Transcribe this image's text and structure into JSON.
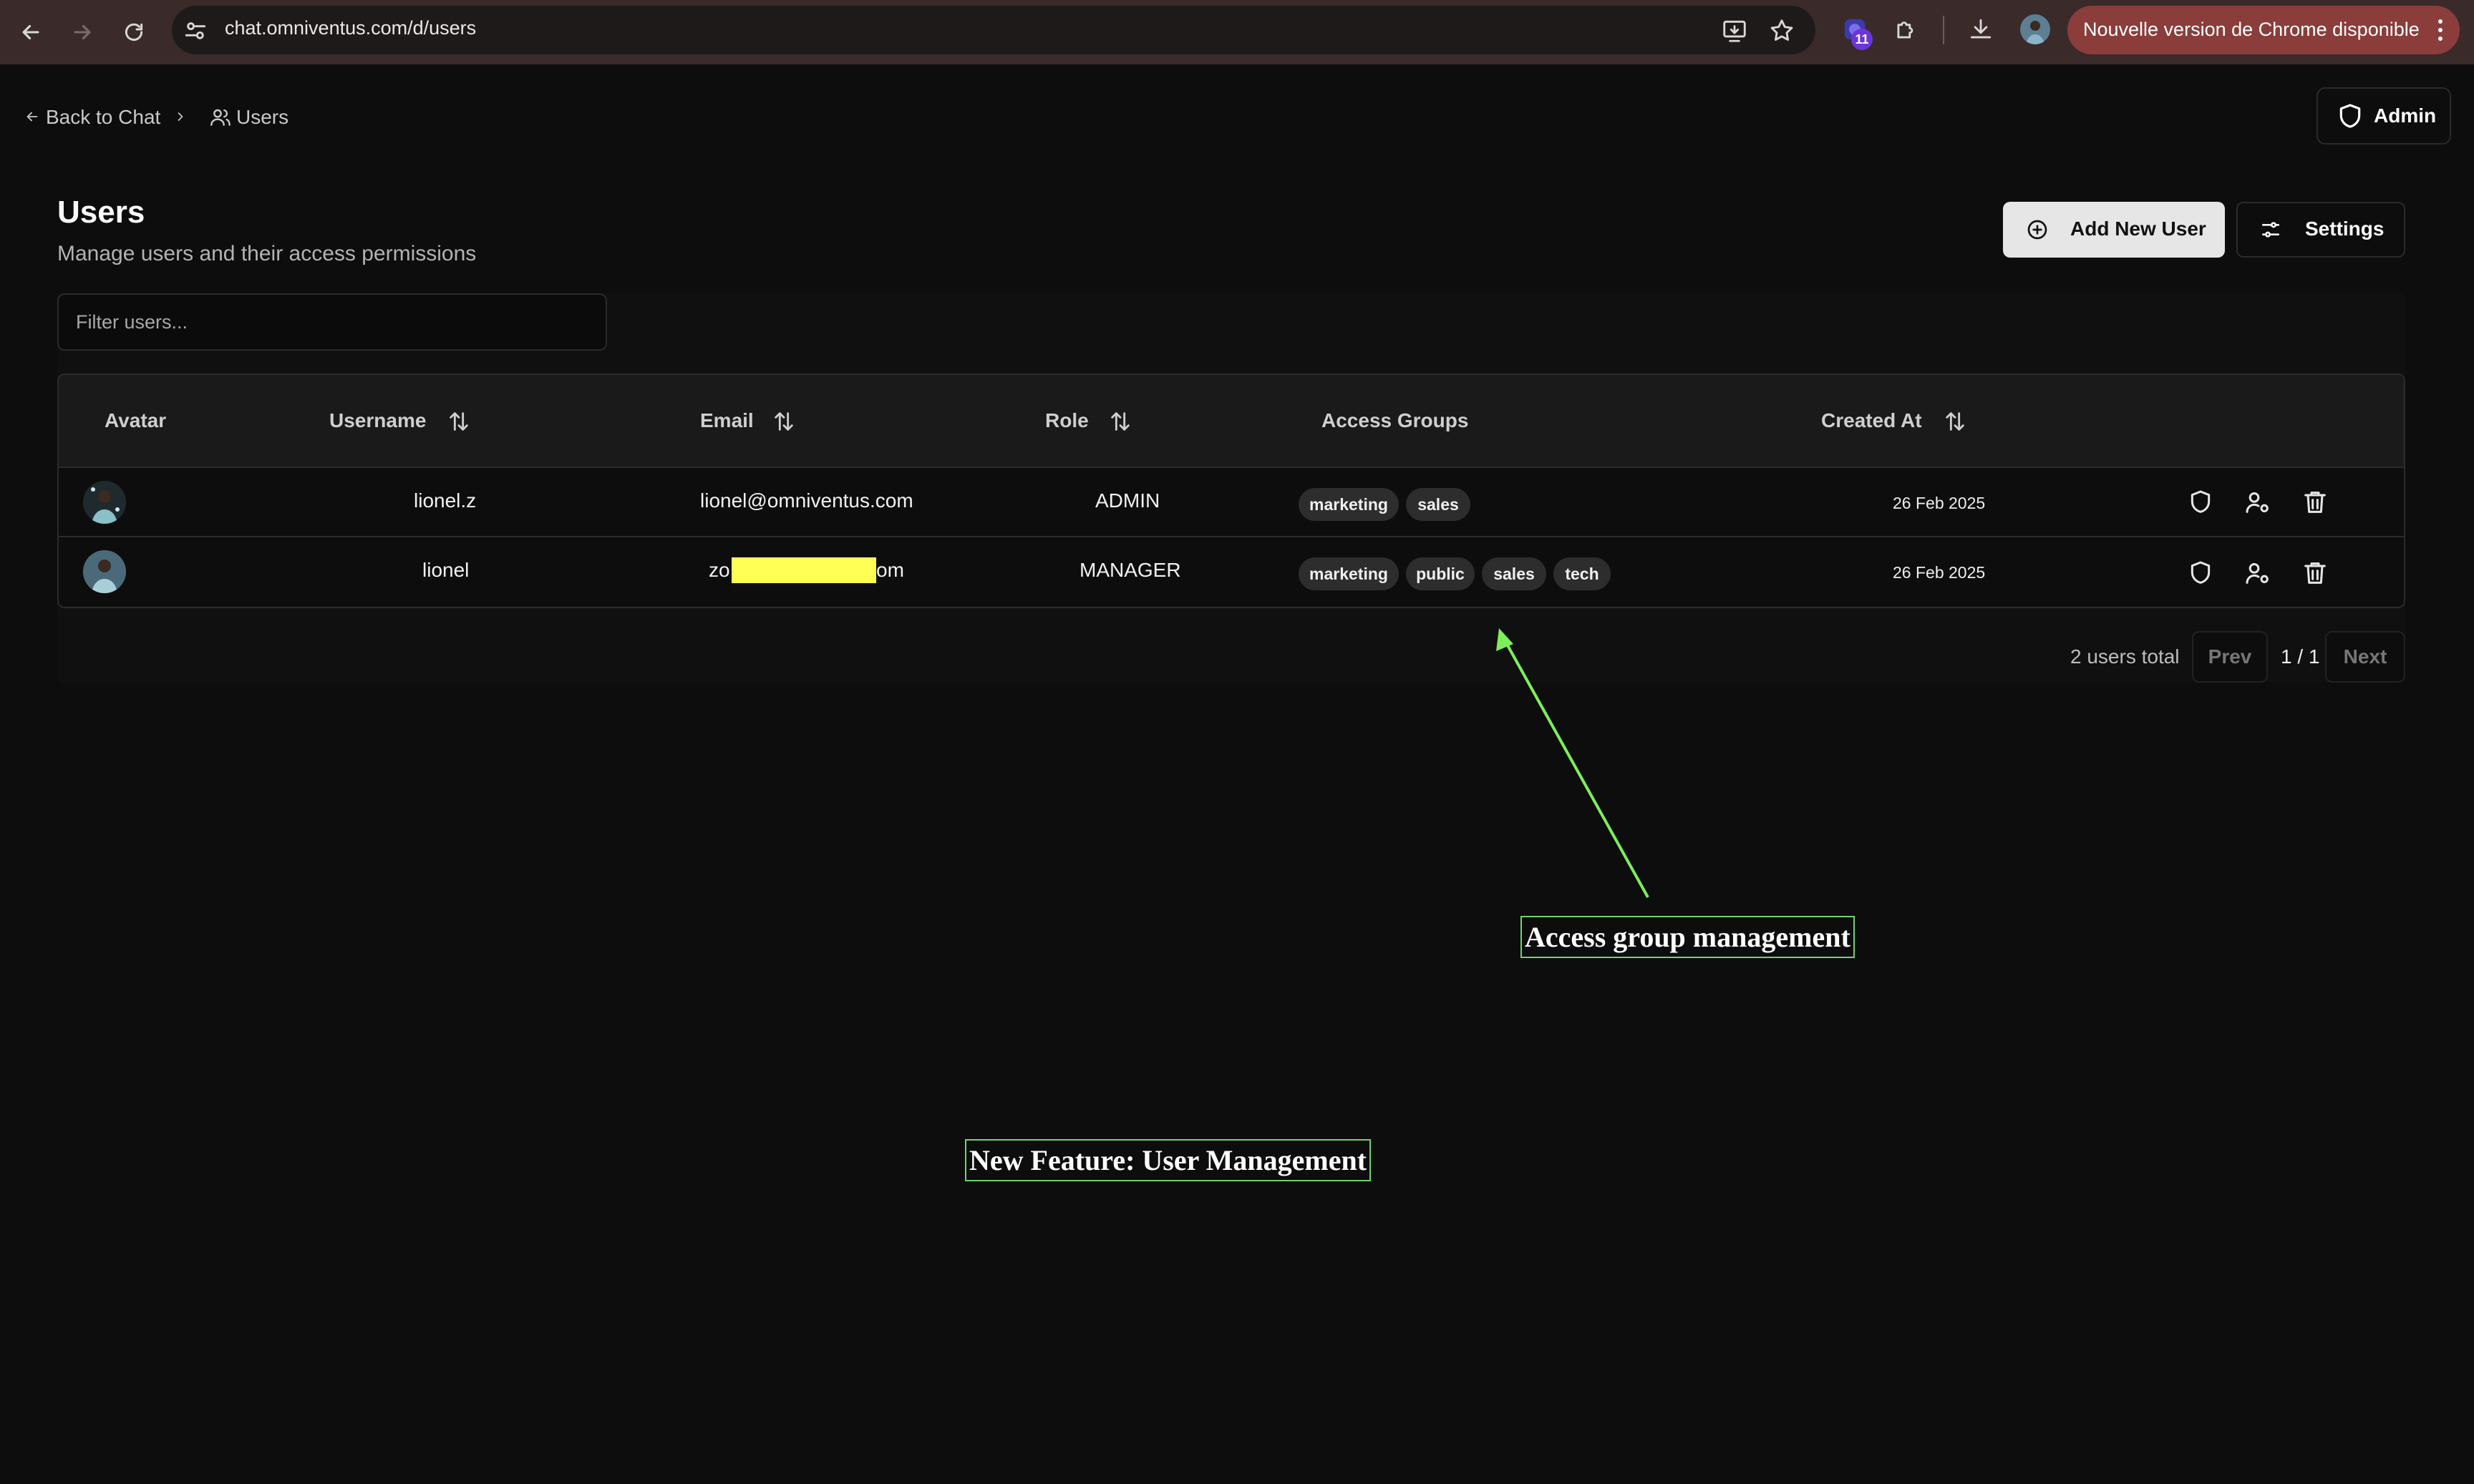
{
  "browser": {
    "url": "chat.omniventus.com/d/users",
    "extension_badge": "11",
    "update_notice": "Nouvelle version de Chrome disponible"
  },
  "breadcrumb": {
    "back_label": "Back to Chat",
    "current_label": "Users"
  },
  "header": {
    "admin_label": "Admin",
    "title": "Users",
    "subtitle": "Manage users and their access permissions",
    "add_user_label": "Add New User",
    "settings_label": "Settings"
  },
  "filter": {
    "placeholder": "Filter users...",
    "value": ""
  },
  "table": {
    "columns": {
      "avatar": "Avatar",
      "username": "Username",
      "email": "Email",
      "role": "Role",
      "access_groups": "Access Groups",
      "created_at": "Created At"
    },
    "rows": [
      {
        "username": "lionel.z",
        "email": "lionel@omniventus.com",
        "role": "ADMIN",
        "groups": [
          "marketing",
          "sales"
        ],
        "created_at": "26 Feb 2025"
      },
      {
        "username": "lionel",
        "email_prefix": "zo",
        "email_suffix": "om",
        "role": "MANAGER",
        "groups": [
          "marketing",
          "public",
          "sales",
          "tech"
        ],
        "created_at": "26 Feb 2025"
      }
    ]
  },
  "pagination": {
    "total": "2 users total",
    "prev_label": "Prev",
    "page": "1 / 1",
    "next_label": "Next"
  },
  "annotations": {
    "access_groups": "Access group management",
    "new_feature": "New Feature: User Management"
  },
  "colors": {
    "background": "#0d0d0d",
    "redaction": "#ffff55",
    "annotation_border": "#6fd36f",
    "arrow": "#7cf05a"
  }
}
